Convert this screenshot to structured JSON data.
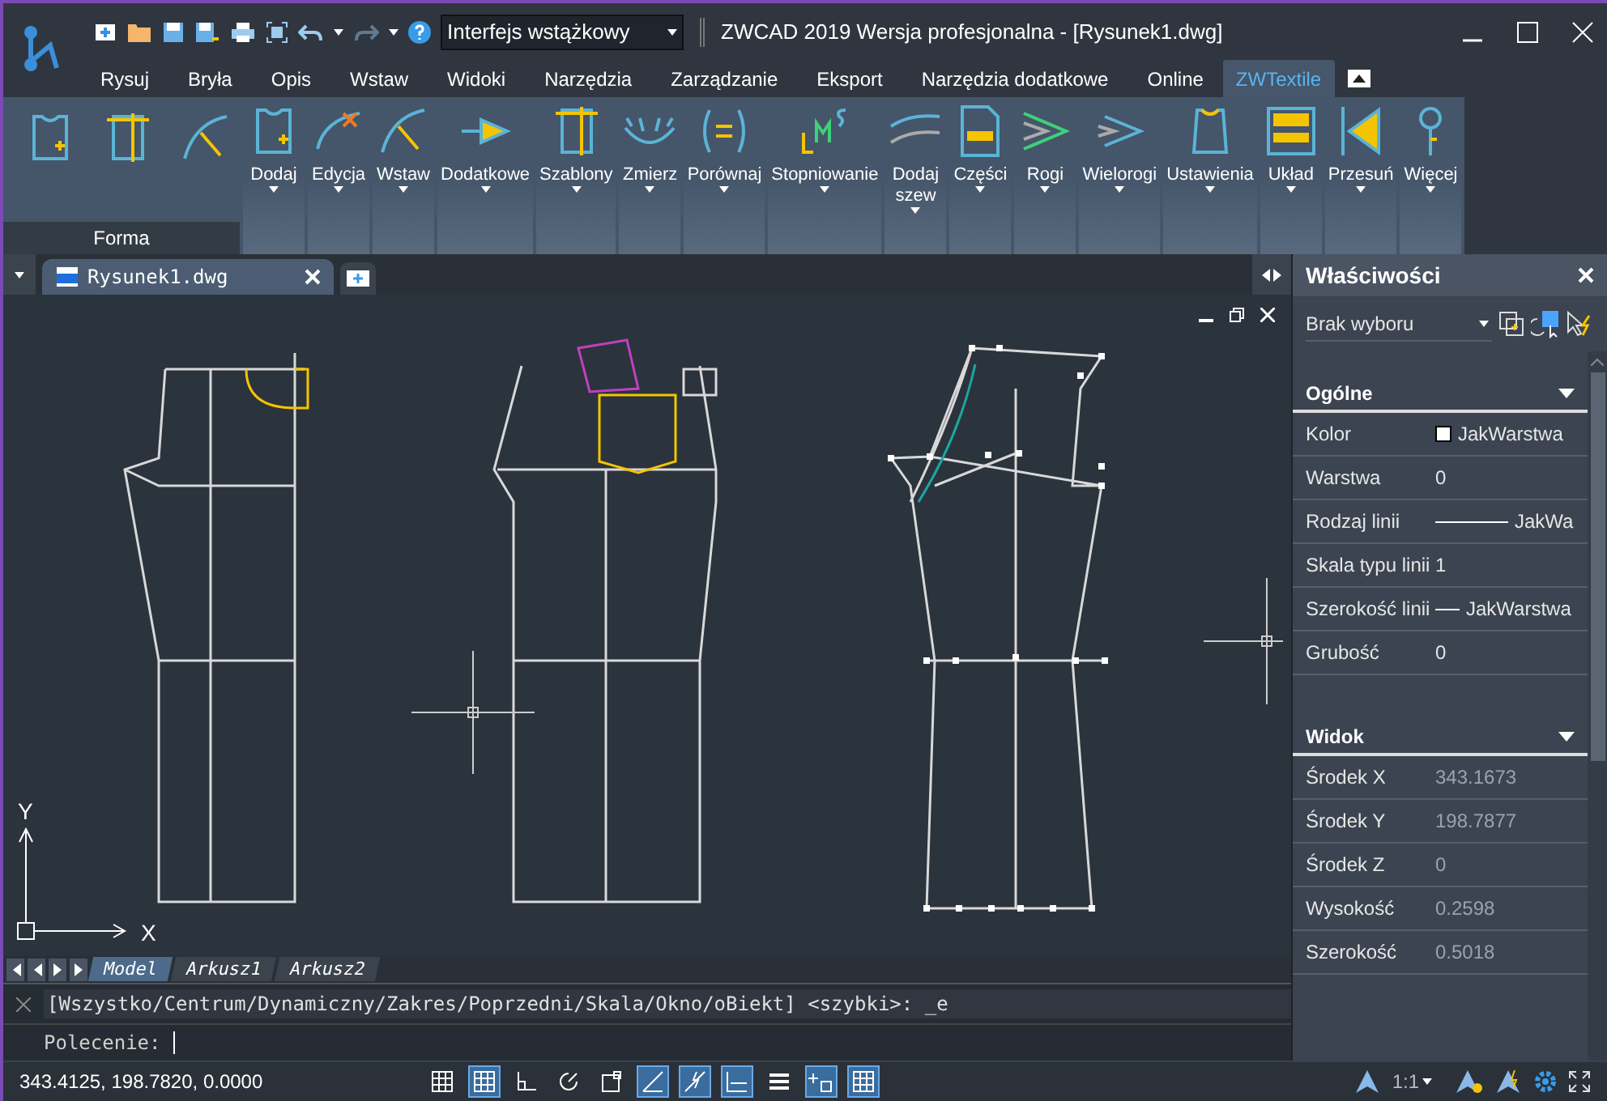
{
  "window": {
    "title": "ZWCAD 2019 Wersja profesjonalna - [Rysunek1.dwg]",
    "workspace": "Interfejs wstążkowy"
  },
  "menu_tabs": [
    {
      "label": "Rysuj",
      "selected": false
    },
    {
      "label": "Bryła",
      "selected": false
    },
    {
      "label": "Opis",
      "selected": false
    },
    {
      "label": "Wstaw",
      "selected": false
    },
    {
      "label": "Widoki",
      "selected": false
    },
    {
      "label": "Narzędzia",
      "selected": false
    },
    {
      "label": "Zarządzanie",
      "selected": false
    },
    {
      "label": "Eksport",
      "selected": false
    },
    {
      "label": "Narzędzia dodatkowe",
      "selected": false
    },
    {
      "label": "Online",
      "selected": false
    },
    {
      "label": "ZWTextile",
      "selected": true
    }
  ],
  "ribbon": {
    "panel_title": "Forma",
    "tools": [
      "Dodaj",
      "Edycja",
      "Wstaw",
      "Dodatkowe",
      "Szablony",
      "Zmierz",
      "Porównaj",
      "Stopniowanie",
      "Dodaj szew",
      "Części",
      "Rogi",
      "Wielorogi",
      "Ustawienia",
      "Układ",
      "Przesuń",
      "Więcej"
    ]
  },
  "document_tabs": [
    {
      "label": "Rysunek1.dwg",
      "selected": true
    }
  ],
  "canvas": {
    "x_axis": "X",
    "y_axis": "Y"
  },
  "layout_tabs": [
    {
      "label": "Model",
      "selected": true
    },
    {
      "label": "Arkusz1",
      "selected": false
    },
    {
      "label": "Arkusz2",
      "selected": false
    }
  ],
  "command_line": {
    "history": "[Wszystko/Centrum/Dynamiczny/Zakres/Poprzedni/Skala/Okno/oBiekt] <szybki>: _e",
    "prompt": "Polecenie:"
  },
  "properties": {
    "title": "Właściwości",
    "selection": "Brak wyboru",
    "sections": [
      {
        "title": "Ogólne",
        "rows": [
          {
            "label": "Kolor",
            "value": "JakWarstwa",
            "kind": "swatch"
          },
          {
            "label": "Warstwa",
            "value": "0",
            "kind": "text"
          },
          {
            "label": "Rodzaj linii",
            "value": "JakWa",
            "kind": "line"
          },
          {
            "label": "Skala typu linii",
            "value": "1",
            "kind": "text"
          },
          {
            "label": "Szerokość linii",
            "value": "JakWarstwa",
            "kind": "shortline"
          },
          {
            "label": "Grubość",
            "value": "0",
            "kind": "text"
          }
        ]
      },
      {
        "title": "Widok",
        "rows": [
          {
            "label": "Środek X",
            "value": "343.1673",
            "kind": "dim"
          },
          {
            "label": "Środek Y",
            "value": "198.7877",
            "kind": "dim"
          },
          {
            "label": "Środek Z",
            "value": "0",
            "kind": "dim"
          },
          {
            "label": "Wysokość",
            "value": "0.2598",
            "kind": "dim"
          },
          {
            "label": "Szerokość",
            "value": "0.5018",
            "kind": "dim"
          }
        ]
      }
    ]
  },
  "status_bar": {
    "coordinates": "343.4125, 198.7820, 0.0000",
    "toggles": [
      {
        "on": false
      },
      {
        "on": true
      },
      {
        "on": false
      },
      {
        "on": false
      },
      {
        "on": false
      },
      {
        "on": true
      },
      {
        "on": true
      },
      {
        "on": true
      },
      {
        "on": false
      },
      {
        "on": true
      },
      {
        "on": true
      }
    ],
    "scale": "1:1"
  }
}
